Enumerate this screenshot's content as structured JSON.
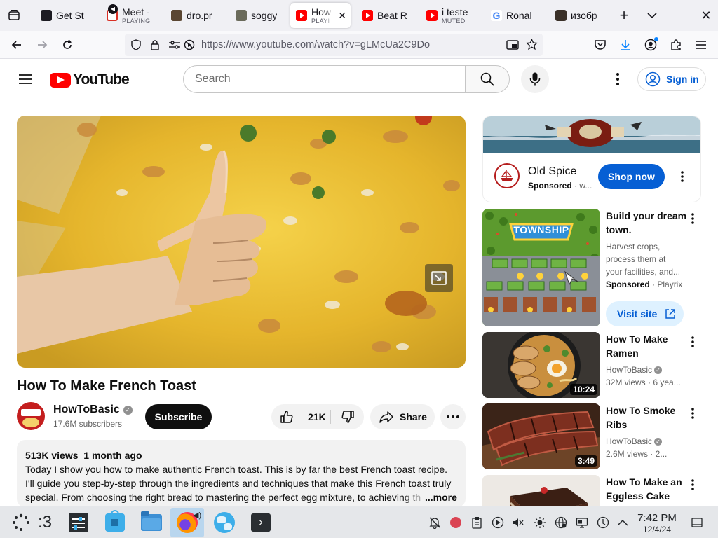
{
  "browser": {
    "tabs": [
      {
        "title": "Get St",
        "subtitle": ""
      },
      {
        "title": "Meet -",
        "subtitle": "PLAYING"
      },
      {
        "title": "dro.pr",
        "subtitle": ""
      },
      {
        "title": "soggy",
        "subtitle": ""
      },
      {
        "title": "How",
        "subtitle": "PLAYI"
      },
      {
        "title": "Beat R",
        "subtitle": ""
      },
      {
        "title": "i teste",
        "subtitle": "MUTED"
      },
      {
        "title": "Ronal",
        "subtitle": ""
      },
      {
        "title": "изобр",
        "subtitle": ""
      }
    ],
    "new_tab": "+",
    "url": "https://www.youtube.com/watch?v=gLMcUa2C9Do"
  },
  "youtube": {
    "logo_text": "YouTube",
    "search_placeholder": "Search",
    "sign_in": "Sign in"
  },
  "video": {
    "title": "How To Make French Toast",
    "channel": "HowToBasic",
    "subscribers": "17.6M subscribers",
    "subscribe": "Subscribe",
    "likes": "21K",
    "share": "Share",
    "views": "513K views",
    "posted": "1 month ago",
    "description_lines": [
      "Today I show you how to make authentic French toast. This is by far the best French toast recipe.",
      "I'll guide you step-by-step through the ingredients and techniques that make this French toast truly",
      "special. From choosing the right bread to mastering the perfect egg mixture, to achieving th"
    ],
    "more": "...more"
  },
  "ad": {
    "brand": "Old Spice",
    "sponsored": "Sponsored",
    "dot_more": "· w...",
    "cta": "Shop now"
  },
  "recommendations": [
    {
      "title": "Build your dream town.",
      "desc": [
        "Harvest crops,",
        "process them at",
        "your facilities, and..."
      ],
      "sponsored": "Sponsored",
      "advertiser": "· Playrix",
      "cta": "Visit site",
      "thumb_label": "TOWNSHIP"
    },
    {
      "title": "How To Make Ramen",
      "channel": "HowToBasic",
      "meta": "32M views · 6 yea...",
      "duration": "10:24"
    },
    {
      "title": "How To Smoke Ribs",
      "channel": "HowToBasic",
      "meta": "2.6M views · 2...",
      "duration": "3:49"
    },
    {
      "title": "How To Make an Eggless Cake",
      "channel": "",
      "meta": "",
      "duration": ""
    }
  ],
  "taskbar": {
    "clock_time": "7:42 PM",
    "clock_date": "12/4/24",
    "launcher_text": ":3"
  },
  "colors": {
    "yt_red": "#ff0000",
    "link_blue": "#065fd4",
    "shop_blue": "#065fd4",
    "video_yellow": "#e1b830"
  }
}
